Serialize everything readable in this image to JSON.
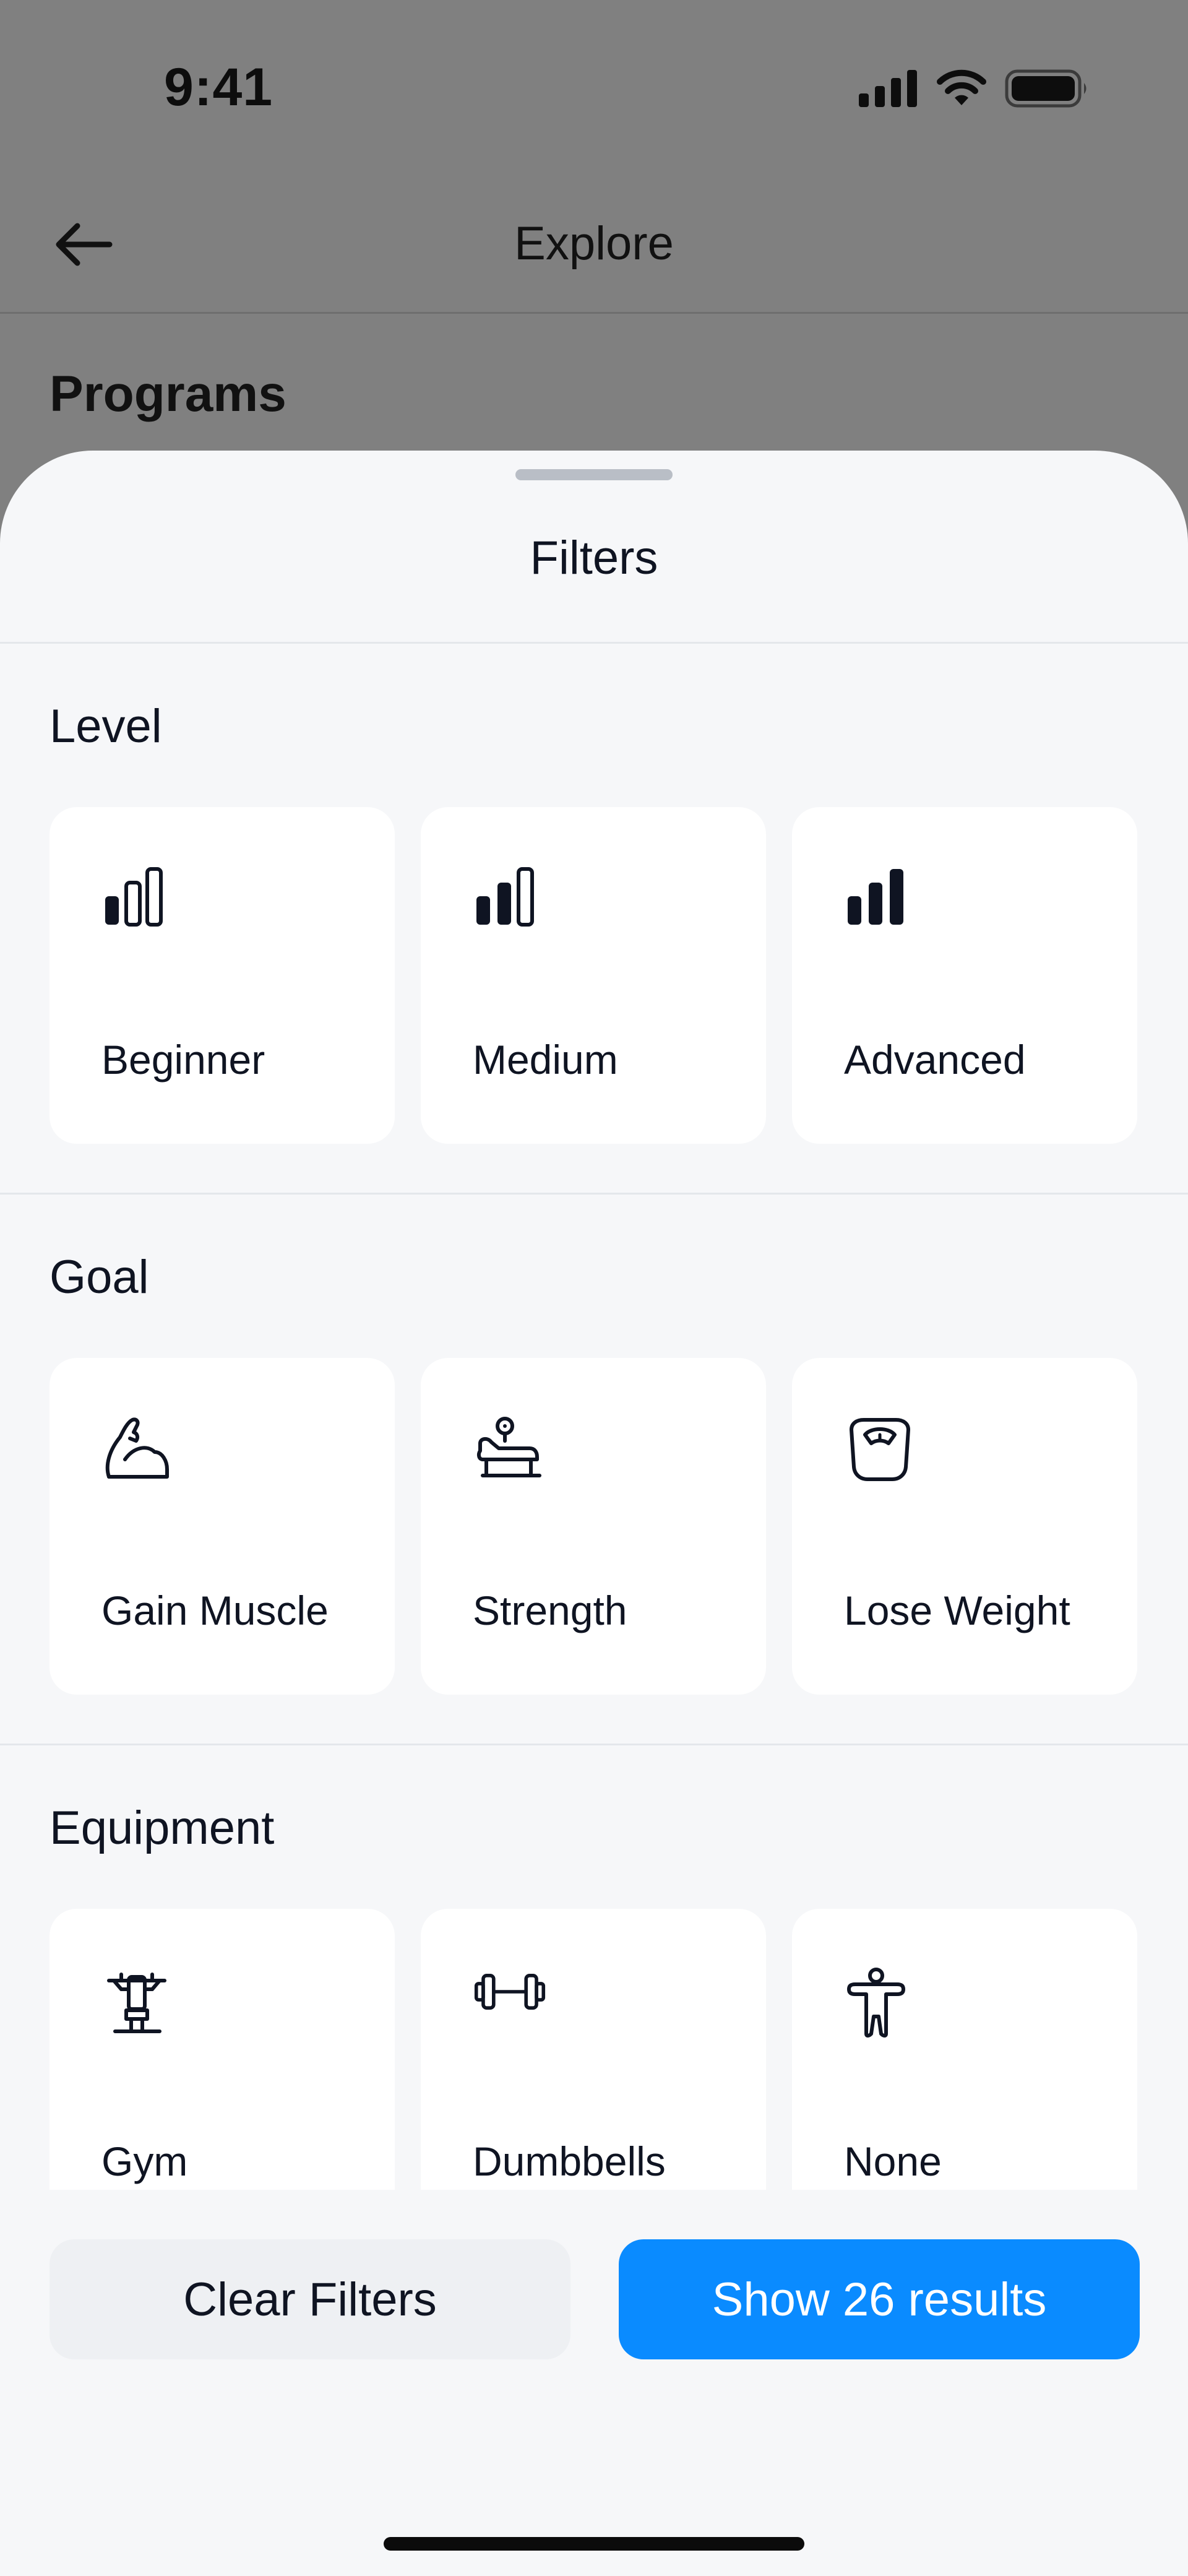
{
  "status_bar": {
    "time": "9:41"
  },
  "nav": {
    "title": "Explore"
  },
  "background": {
    "section_title": "Programs"
  },
  "sheet": {
    "title": "Filters",
    "groups": [
      {
        "title": "Level",
        "options": [
          {
            "label": "Beginner",
            "icon": "signal-level-1-icon"
          },
          {
            "label": "Medium",
            "icon": "signal-level-2-icon"
          },
          {
            "label": "Advanced",
            "icon": "signal-level-3-icon"
          }
        ]
      },
      {
        "title": "Goal",
        "options": [
          {
            "label": "Gain Muscle",
            "icon": "flexed-bicep-icon"
          },
          {
            "label": "Strength",
            "icon": "bench-press-icon"
          },
          {
            "label": "Lose Weight",
            "icon": "scale-icon"
          }
        ]
      },
      {
        "title": "Equipment",
        "options": [
          {
            "label": "Gym",
            "icon": "gym-machine-icon"
          },
          {
            "label": "Dumbbells",
            "icon": "dumbbell-icon"
          },
          {
            "label": "None",
            "icon": "person-icon"
          }
        ]
      }
    ]
  },
  "actions": {
    "clear_label": "Clear Filters",
    "show_label": "Show 26 results"
  },
  "colors": {
    "primary": "#0A8BFF",
    "sheet_bg": "#F6F7F9",
    "overlay": "#808080",
    "text": "#0F1422"
  }
}
